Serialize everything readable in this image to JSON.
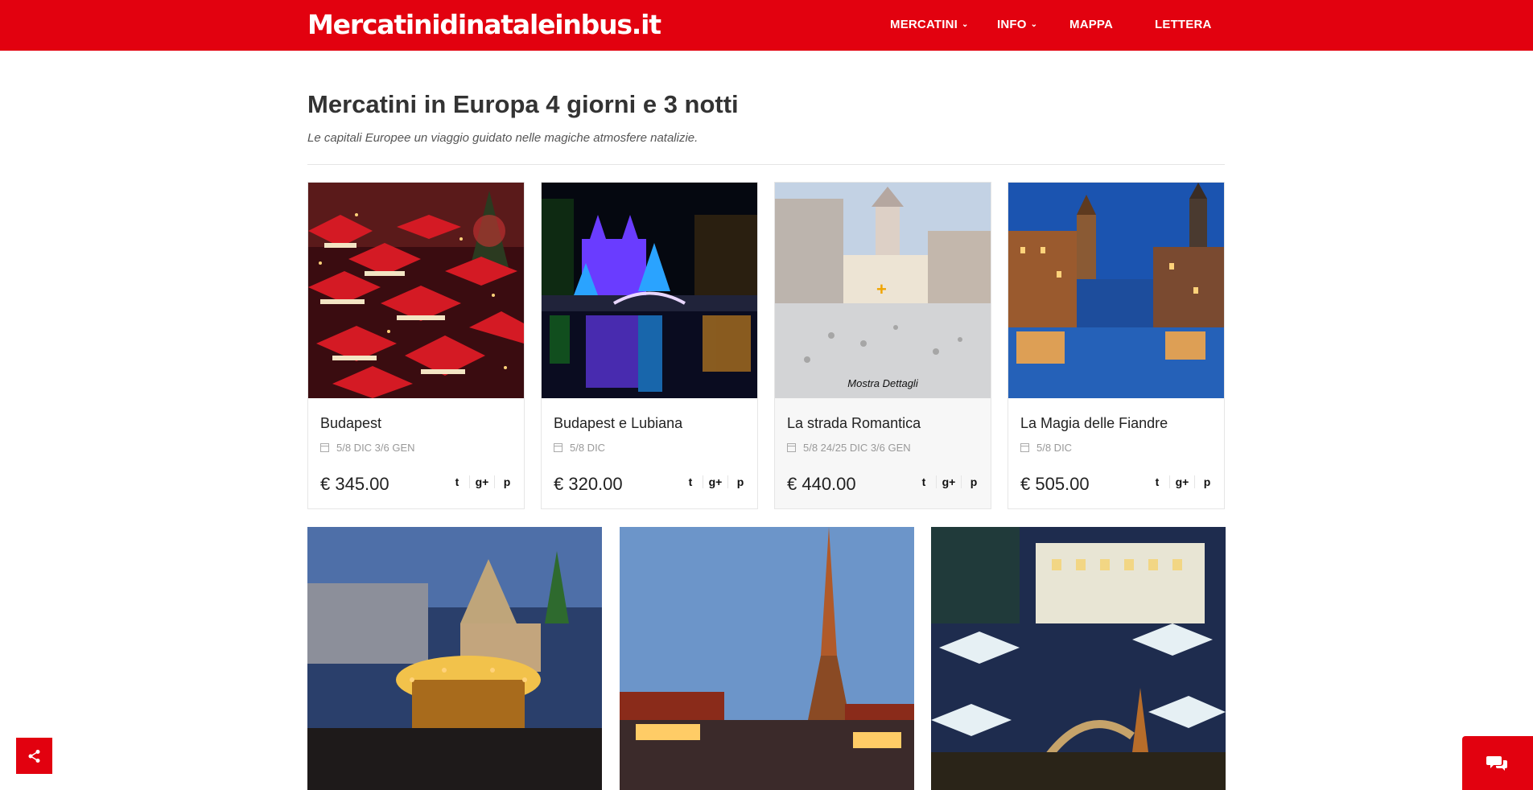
{
  "header": {
    "logo": "Mercatinidinataleinbus.it",
    "nav": [
      {
        "label": "MERCATINI",
        "has_dropdown": true
      },
      {
        "label": "INFO",
        "has_dropdown": true
      },
      {
        "label": "MAPPA",
        "has_dropdown": false
      },
      {
        "label": "LETTERA",
        "has_dropdown": false
      }
    ],
    "color": "#e2010f"
  },
  "main": {
    "title": "Mercatini in Europa 4 giorni e 3 notti",
    "subtitle": "Le capitali Europee un viaggio guidato nelle magiche atmosfere natalizie."
  },
  "cards": [
    {
      "title": "Budapest",
      "date": "5/8 DIC 3/6 GEN",
      "price": "€ 345.00",
      "image": "christmas-market-red-stalls",
      "hover": false
    },
    {
      "title": "Budapest e Lubiana",
      "date": "5/8 DIC",
      "price": "€ 320.00",
      "image": "night-river-bridge-lights",
      "hover": false
    },
    {
      "title": "La strada Romantica",
      "date": "5/8 24/25 DIC 3/6 GEN",
      "price": "€ 440.00",
      "image": "old-town-street-tower",
      "hover": true,
      "hover_label": "Mostra Dettagli"
    },
    {
      "title": "La Magia delle Fiandre",
      "date": "5/8 DIC",
      "price": "€ 505.00",
      "image": "bruges-canal-belfry",
      "hover": false
    }
  ],
  "share_icons": [
    "twitter-icon",
    "google-plus-icon",
    "pinterest-icon"
  ],
  "share_glyphs": [
    "t",
    "g+",
    "p"
  ],
  "gallery": [
    {
      "image": "frankfurt-carousel-market"
    },
    {
      "image": "paris-eiffel-tower-market"
    },
    {
      "image": "bolzano-christmas-market"
    }
  ],
  "floating": {
    "share_button": "share-icon",
    "chat_button": "chat-icon"
  }
}
